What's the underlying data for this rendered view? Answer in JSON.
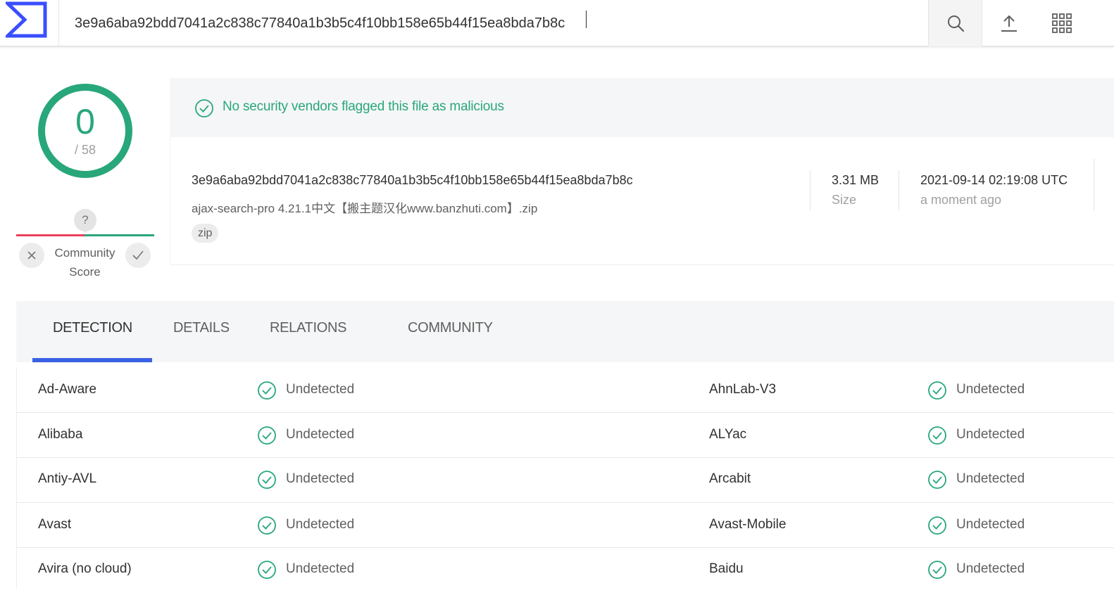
{
  "topbar": {
    "logo": "virustotal-sigma-logo",
    "search_value": "3e9a6aba92bdd7041a2c838c77840a1b3b5c4f10bb158e65b44f15ea8bda7b8c",
    "icons": [
      "search-icon",
      "upload-icon",
      "apps-grid-icon"
    ]
  },
  "score": {
    "detections": "0",
    "total": "/ 58",
    "community_unknown": "?",
    "community_label_line1": "Community",
    "community_label_line2": "Score"
  },
  "banner": {
    "text": "No security vendors flagged this file as malicious"
  },
  "file": {
    "hash": "3e9a6aba92bdd7041a2c838c77840a1b3b5c4f10bb158e65b44f15ea8bda7b8c",
    "name": "ajax-search-pro 4.21.1中文【搬主题汉化www.banzhuti.com】.zip",
    "tag": "zip",
    "size_value": "3.31 MB",
    "size_label": "Size",
    "date_value": "2021-09-14 02:19:08 UTC",
    "date_label": "a moment ago"
  },
  "tabs": [
    {
      "label": "DETECTION",
      "active": true
    },
    {
      "label": "DETAILS",
      "active": false
    },
    {
      "label": "RELATIONS",
      "active": false
    },
    {
      "label": "COMMUNITY",
      "active": false
    }
  ],
  "detections": [
    {
      "left_vendor": "Ad-Aware",
      "left_result": "Undetected",
      "right_vendor": "AhnLab-V3",
      "right_result": "Undetected"
    },
    {
      "left_vendor": "Alibaba",
      "left_result": "Undetected",
      "right_vendor": "ALYac",
      "right_result": "Undetected"
    },
    {
      "left_vendor": "Antiy-AVL",
      "left_result": "Undetected",
      "right_vendor": "Arcabit",
      "right_result": "Undetected"
    },
    {
      "left_vendor": "Avast",
      "left_result": "Undetected",
      "right_vendor": "Avast-Mobile",
      "right_result": "Undetected"
    },
    {
      "left_vendor": "Avira (no cloud)",
      "left_result": "Undetected",
      "right_vendor": "Baidu",
      "right_result": "Undetected"
    }
  ],
  "colors": {
    "clean_green": "#28a77a",
    "malicious_red": "#e8405a",
    "accent_blue": "#3b61e4",
    "logo_blue": "#394eff"
  }
}
